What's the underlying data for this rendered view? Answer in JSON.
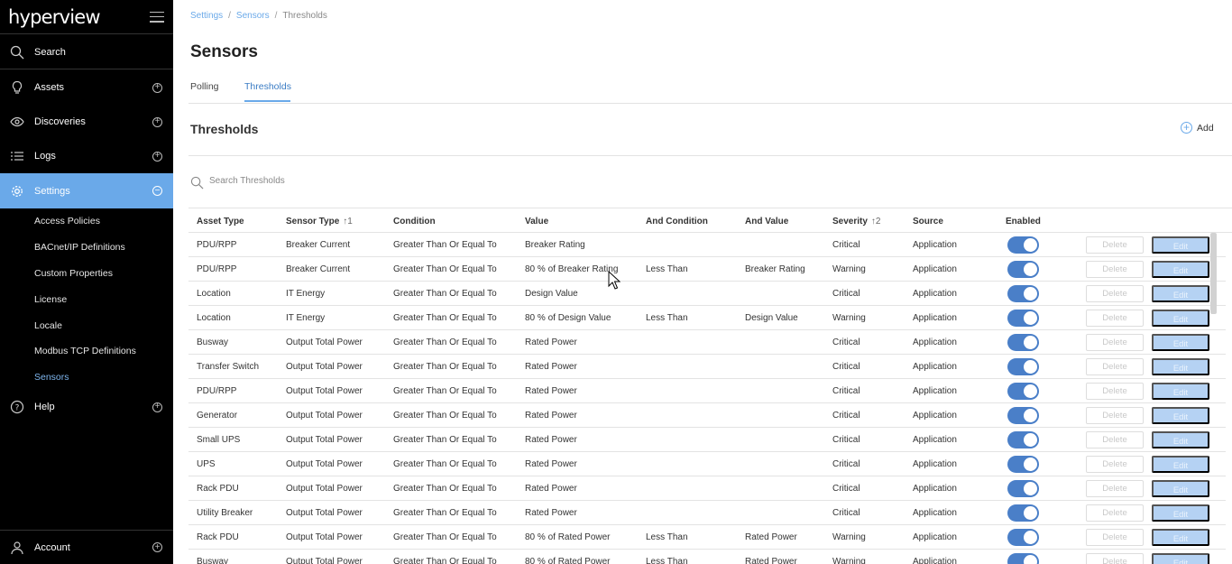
{
  "app": {
    "logo": "hyperview"
  },
  "sidebar": {
    "search_label": "Search",
    "items": [
      {
        "label": "Assets",
        "icon": "lightbulb-icon"
      },
      {
        "label": "Discoveries",
        "icon": "eye-icon"
      },
      {
        "label": "Logs",
        "icon": "list-icon"
      },
      {
        "label": "Settings",
        "icon": "gear-icon"
      },
      {
        "label": "Help",
        "icon": "help-icon"
      },
      {
        "label": "Account",
        "icon": "user-icon"
      }
    ],
    "settings_sub": [
      "Access Policies",
      "BACnet/IP Definitions",
      "Custom Properties",
      "License",
      "Locale",
      "Modbus TCP Definitions",
      "Sensors"
    ],
    "active_sub": "Sensors",
    "accent_color": "#6aa9e9"
  },
  "breadcrumb": {
    "items": [
      "Settings",
      "Sensors",
      "Thresholds"
    ]
  },
  "page": {
    "title": "Sensors"
  },
  "tabs": [
    {
      "label": "Polling"
    },
    {
      "label": "Thresholds"
    }
  ],
  "section": {
    "title": "Thresholds",
    "add_label": "Add"
  },
  "search": {
    "placeholder": "Search Thresholds"
  },
  "table": {
    "columns": [
      "Asset Type",
      "Sensor Type",
      "Condition",
      "Value",
      "And Condition",
      "And Value",
      "Severity",
      "Source",
      "Enabled"
    ],
    "sort": {
      "sensor_type": "↑1",
      "severity": "↑2"
    },
    "delete_label": "Delete",
    "edit_label": "Edit",
    "rows": [
      [
        "PDU/RPP",
        "Breaker Current",
        "Greater Than Or Equal To",
        "Breaker Rating",
        "",
        "",
        "Critical",
        "Application"
      ],
      [
        "PDU/RPP",
        "Breaker Current",
        "Greater Than Or Equal To",
        "80 % of Breaker Rating",
        "Less Than",
        "Breaker Rating",
        "Warning",
        "Application"
      ],
      [
        "Location",
        "IT Energy",
        "Greater Than Or Equal To",
        "Design Value",
        "",
        "",
        "Critical",
        "Application"
      ],
      [
        "Location",
        "IT Energy",
        "Greater Than Or Equal To",
        "80 % of Design Value",
        "Less Than",
        "Design Value",
        "Warning",
        "Application"
      ],
      [
        "Busway",
        "Output Total Power",
        "Greater Than Or Equal To",
        "Rated Power",
        "",
        "",
        "Critical",
        "Application"
      ],
      [
        "Transfer Switch",
        "Output Total Power",
        "Greater Than Or Equal To",
        "Rated Power",
        "",
        "",
        "Critical",
        "Application"
      ],
      [
        "PDU/RPP",
        "Output Total Power",
        "Greater Than Or Equal To",
        "Rated Power",
        "",
        "",
        "Critical",
        "Application"
      ],
      [
        "Generator",
        "Output Total Power",
        "Greater Than Or Equal To",
        "Rated Power",
        "",
        "",
        "Critical",
        "Application"
      ],
      [
        "Small UPS",
        "Output Total Power",
        "Greater Than Or Equal To",
        "Rated Power",
        "",
        "",
        "Critical",
        "Application"
      ],
      [
        "UPS",
        "Output Total Power",
        "Greater Than Or Equal To",
        "Rated Power",
        "",
        "",
        "Critical",
        "Application"
      ],
      [
        "Rack PDU",
        "Output Total Power",
        "Greater Than Or Equal To",
        "Rated Power",
        "",
        "",
        "Critical",
        "Application"
      ],
      [
        "Utility Breaker",
        "Output Total Power",
        "Greater Than Or Equal To",
        "Rated Power",
        "",
        "",
        "Critical",
        "Application"
      ],
      [
        "Rack PDU",
        "Output Total Power",
        "Greater Than Or Equal To",
        "80 % of Rated Power",
        "Less Than",
        "Rated Power",
        "Warning",
        "Application"
      ],
      [
        "Busway",
        "Output Total Power",
        "Greater Than Or Equal To",
        "80 % of Rated Power",
        "Less Than",
        "Rated Power",
        "Warning",
        "Application"
      ]
    ]
  }
}
